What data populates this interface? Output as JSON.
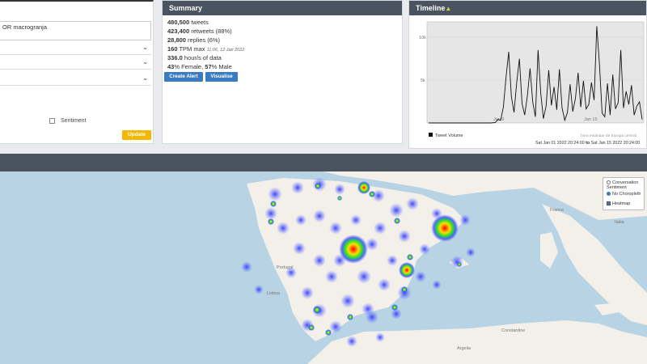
{
  "query": {
    "text": "OR macrogranja",
    "sentiment_label": "Sentiment",
    "update_label": "Update"
  },
  "summary": {
    "title": "Summary",
    "tweets_value": "480,500",
    "tweets_label": "tweets",
    "retweets_value": "423,400",
    "retweets_label": "retweets (88%)",
    "replies_value": "28,800",
    "replies_label": "replies (6%)",
    "tpm_value": "160",
    "tpm_label": "TPM max",
    "tpm_time": "11:06, 12 Jan 2022",
    "hours_value": "336.0",
    "hours_label": "hour/s of data",
    "female_value": "43",
    "female_label": "% Female,",
    "male_value": "57",
    "male_label": "% Male",
    "create_alert_label": "Create Alert",
    "visualise_label": "Visualise"
  },
  "timeline": {
    "title": "Timeline",
    "warning_icon": "warning-triangle-icon",
    "legend": "Tweet Volume",
    "timezone_note": "hora estándar de Europa central",
    "range_start": "Sat Jan 01 2022 20:24:00",
    "range_to": "to",
    "range_end": "Sat Jan 15 2022 20:24:00",
    "chart_data": {
      "type": "line",
      "y_ticks": [
        "10k",
        "5k"
      ],
      "x_ticks": [
        "Jan 9",
        "Jan 15"
      ],
      "ylim": [
        0,
        11500
      ],
      "series": [
        {
          "name": "Tweet Volume",
          "x": [
            0,
            0.5,
            1,
            1.5,
            2,
            2.5,
            3,
            3.5,
            4,
            4.5,
            5,
            5.5,
            6,
            6.5,
            7,
            7.5,
            7.8,
            8.1,
            8.4,
            8.7,
            9,
            9.3,
            9.6,
            9.9,
            10.2,
            10.5,
            10.8,
            11.1,
            11.4,
            11.7,
            12,
            12.3,
            12.6,
            12.9,
            13.2,
            13.5,
            13.8,
            14.1,
            14.4,
            14.7,
            15,
            15.3,
            15.6,
            15.9,
            16.2,
            16.5,
            16.8,
            17.1,
            17.4,
            17.7,
            18,
            18.3,
            18.6,
            18.9,
            19.2,
            19.5,
            19.8,
            20.1,
            20.4,
            20.7,
            21,
            21.3,
            21.6,
            21.9,
            22.2,
            22.5,
            22.8,
            23.1,
            23.4,
            23.7,
            24
          ],
          "values": [
            0,
            0,
            0,
            0,
            0,
            0,
            0,
            0,
            0,
            0,
            0,
            0,
            0,
            0,
            0,
            50,
            400,
            300,
            1800,
            5200,
            8100,
            3000,
            1200,
            4600,
            7300,
            2200,
            900,
            3100,
            6200,
            2400,
            700,
            8300,
            3400,
            500,
            1900,
            6000,
            2000,
            4100,
            1500,
            6100,
            1700,
            300,
            1200,
            4400,
            1300,
            2800,
            5700,
            1800,
            4800,
            1600,
            2100,
            4600,
            2600,
            11000,
            6700,
            1100,
            700,
            4500,
            900,
            5500,
            1600,
            2300,
            8300,
            1700,
            3600,
            2100,
            4300,
            900,
            1900,
            2400,
            400
          ]
        }
      ]
    }
  },
  "map": {
    "labels": {
      "portugal": "Portugal",
      "lisboa": "Lisboa",
      "francia": "France",
      "italia": "Italia",
      "argelia": "Argelia",
      "constantine": "Constantine"
    },
    "layers": {
      "conversation": "Conversation Sentiment",
      "no_choropleth": "No Choropleth",
      "heatmap": "Heatmap"
    }
  }
}
